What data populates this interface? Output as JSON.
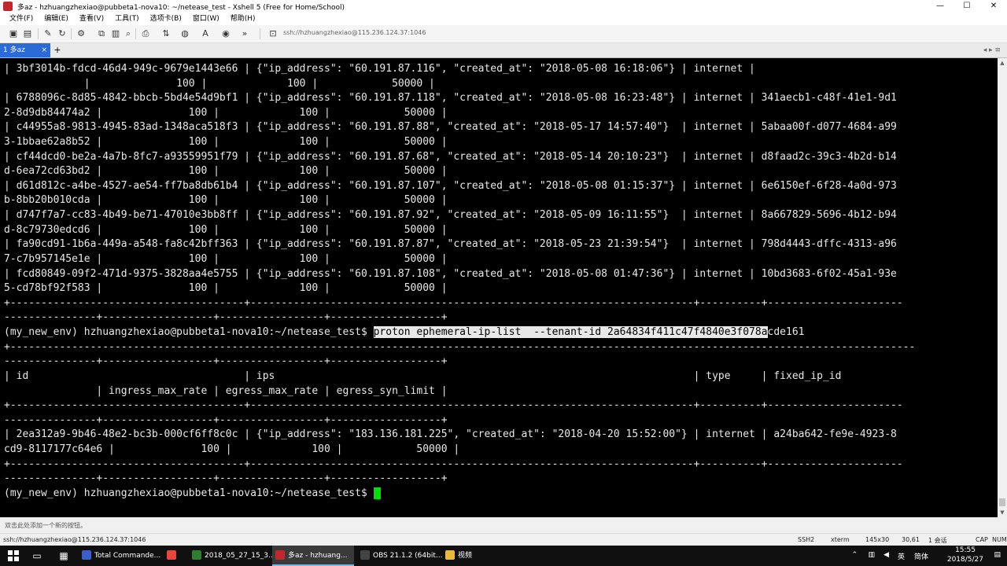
{
  "window": {
    "title": "多az   - hzhuangzhexiao@pubbeta1-nova10: ~/netease_test - Xshell 5 (Free for Home/School)",
    "controls": [
      "—",
      "☐",
      "✕"
    ]
  },
  "menu": [
    "文件(F)",
    "编辑(E)",
    "查看(V)",
    "工具(T)",
    "选项卡(B)",
    "窗口(W)",
    "帮助(H)"
  ],
  "toolbar": {
    "address": "ssh://hzhuangzhexiao@115.236.124.37:1046"
  },
  "tabs": {
    "active_label": "1 多az",
    "close": "×",
    "add": "+",
    "nav": "◂ ▸ ≡"
  },
  "terminal": {
    "lines": [
      "| 3bf3014b-fdcd-46d4-949c-9679e1443e66 | {\"ip_address\": \"60.191.87.116\", \"created_at\": \"2018-05-08 16:18:06\"} | internet |",
      "             |              100 |             100 |            50000 |",
      "| 6788096c-8d85-4842-bbcb-5bd4e54d9bf1 | {\"ip_address\": \"60.191.87.118\", \"created_at\": \"2018-05-08 16:23:48\"} | internet | 341aecb1-c48f-41e1-9d1",
      "2-8d9db84474a2 |              100 |             100 |            50000 |",
      "| c44955a8-9813-4945-83ad-1348aca518f3 | {\"ip_address\": \"60.191.87.88\", \"created_at\": \"2018-05-17 14:57:40\"}  | internet | 5abaa00f-d077-4684-a99",
      "3-1bbae62a8b52 |              100 |             100 |            50000 |",
      "| cf44dcd0-be2a-4a7b-8fc7-a93559951f79 | {\"ip_address\": \"60.191.87.68\", \"created_at\": \"2018-05-14 20:10:23\"}  | internet | d8faad2c-39c3-4b2d-b14",
      "d-6ea72cd63bd2 |              100 |             100 |            50000 |",
      "| d61d812c-a4be-4527-ae54-ff7ba8db61b4 | {\"ip_address\": \"60.191.87.107\", \"created_at\": \"2018-05-08 01:15:37\"} | internet | 6e6150ef-6f28-4a0d-973",
      "b-8bb20b010cda |              100 |             100 |            50000 |",
      "| d747f7a7-cc83-4b49-be71-47010e3bb8ff | {\"ip_address\": \"60.191.87.92\", \"created_at\": \"2018-05-09 16:11:55\"}  | internet | 8a667829-5696-4b12-b94",
      "d-8c79730edcd6 |              100 |             100 |            50000 |",
      "| fa90cd91-1b6a-449a-a548-fa8c42bff363 | {\"ip_address\": \"60.191.87.87\", \"created_at\": \"2018-05-23 21:39:54\"}  | internet | 798d4443-dffc-4313-a96",
      "7-c7b957145e1e |              100 |             100 |            50000 |",
      "| fcd80849-09f2-471d-9375-3828aa4e5755 | {\"ip_address\": \"60.191.87.108\", \"created_at\": \"2018-05-08 01:47:36\"} | internet | 10bd3683-6f02-45a1-93e",
      "5-cd78bf92f583 |              100 |             100 |            50000 |",
      "+--------------------------------------+------------------------------------------------------------------------+----------+----------------------",
      "---------------+------------------+-----------------+------------------+",
      "",
      "+---------------------------------------------------------------------------------------------------------------------------------------------------",
      "---------------+------------------+-----------------+------------------+",
      "| id                                   | ips                                                                    | type     | fixed_ip_id",
      "               | ingress_max_rate | egress_max_rate | egress_syn_limit |",
      "+--------------------------------------+------------------------------------------------------------------------+----------+----------------------",
      "---------------+------------------+-----------------+------------------+",
      "| 2ea312a9-9b46-48e2-bc3b-000cf6ff8c0c | {\"ip_address\": \"183.136.181.225\", \"created_at\": \"2018-04-20 15:52:00\"} | internet | a24ba642-fe9e-4923-8",
      "cd9-8117177c64e6 |              100 |             100 |            50000 |",
      "+--------------------------------------+------------------------------------------------------------------------+----------+----------------------",
      "---------------+------------------+-----------------+------------------+"
    ],
    "prompt": "(my_new_env) hzhuangzhexiao@pubbeta1-nova10:~/netease_test$ ",
    "command_selected": "proton ephemeral-ip-list  --tenant-id 2a64834f411c47f4840e3f078a",
    "command_rest": "cde161"
  },
  "hint": "双击此处添加一个新的按钮。",
  "status": {
    "connection": "ssh://hzhuangzhexiao@115.236.124.37:1046",
    "protocol": "SSH2",
    "term": "xterm",
    "size": "145x30",
    "pos": "30,61",
    "sessions": "1 会话",
    "caps": "CAP",
    "num": "NUM"
  },
  "taskbar": {
    "tasks": [
      {
        "label": "Total Commande...",
        "color": "#3a5fcd"
      },
      {
        "label": "",
        "color": "#e8453c"
      },
      {
        "label": "2018_05_27_15_3...",
        "color": "#2e7d32"
      },
      {
        "label": "多az   - hzhuang...",
        "color": "#c1272d"
      },
      {
        "label": "OBS 21.1.2 (64bit...",
        "color": "#444444"
      },
      {
        "label": "视频",
        "color": "#e8b93c"
      }
    ],
    "ime": "简体",
    "time": "15:55",
    "date": "2018/5/27"
  }
}
